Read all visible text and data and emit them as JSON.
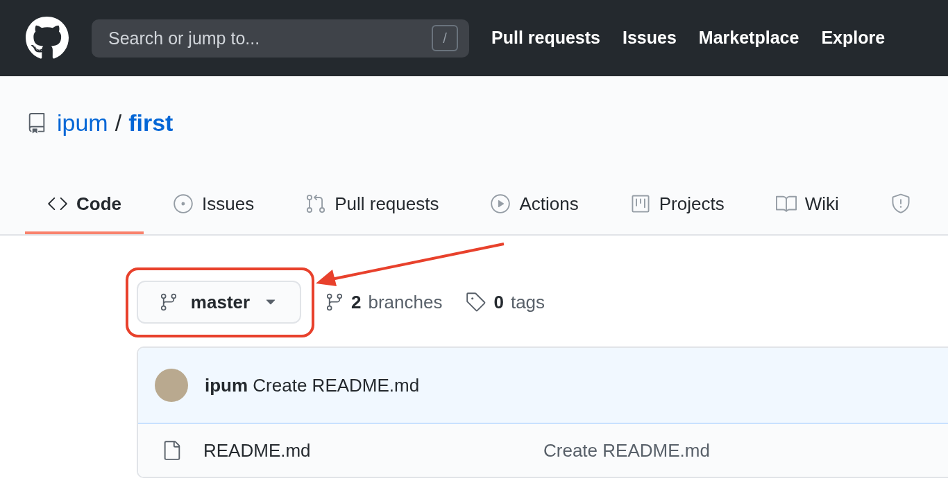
{
  "header": {
    "search": {
      "placeholder": "Search or jump to...",
      "shortcut": "/"
    },
    "nav": [
      "Pull requests",
      "Issues",
      "Marketplace",
      "Explore"
    ]
  },
  "repo": {
    "owner": "ipum",
    "separator": "/",
    "name": "first"
  },
  "tabs": [
    {
      "kind": "code",
      "label": "Code",
      "selected": true
    },
    {
      "kind": "issues",
      "label": "Issues",
      "selected": false
    },
    {
      "kind": "pulls",
      "label": "Pull requests",
      "selected": false
    },
    {
      "kind": "actions",
      "label": "Actions",
      "selected": false
    },
    {
      "kind": "projects",
      "label": "Projects",
      "selected": false
    },
    {
      "kind": "wiki",
      "label": "Wiki",
      "selected": false
    },
    {
      "kind": "security",
      "selected": false
    }
  ],
  "branch_button": {
    "label": "master"
  },
  "branches": {
    "count": "2",
    "label": "branches"
  },
  "tags": {
    "count": "0",
    "label": "tags"
  },
  "commit": {
    "author": "ipum",
    "message": "Create README.md"
  },
  "files": [
    {
      "name": "README.md",
      "message": "Create README.md"
    }
  ],
  "annotation": {
    "highlight": true
  }
}
